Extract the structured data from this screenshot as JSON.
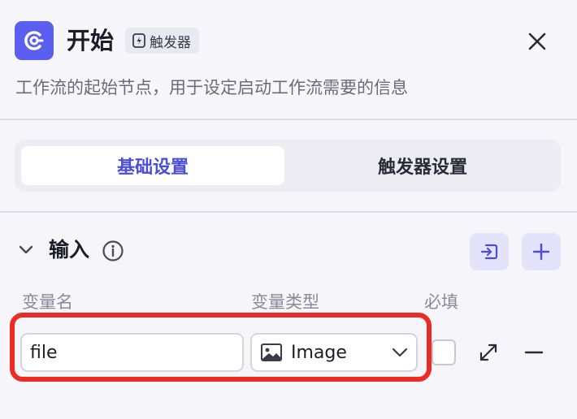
{
  "header": {
    "title": "开始",
    "tag_label": "触发器",
    "description": "工作流的起始节点，用于设定启动工作流需要的信息",
    "icon": "start-node-icon",
    "accent_color": "#5b5ff0"
  },
  "tabs": [
    {
      "label": "基础设置",
      "active": true
    },
    {
      "label": "触发器设置",
      "active": false
    }
  ],
  "input_section": {
    "title": "输入",
    "columns": {
      "name": "变量名",
      "type": "变量类型",
      "required": "必填"
    },
    "variables": [
      {
        "name": "file",
        "type": "Image",
        "type_icon": "image-icon",
        "required": false
      }
    ]
  },
  "colors": {
    "highlight_border": "#ee2a24",
    "active_tab_text": "#4b4ed6"
  }
}
